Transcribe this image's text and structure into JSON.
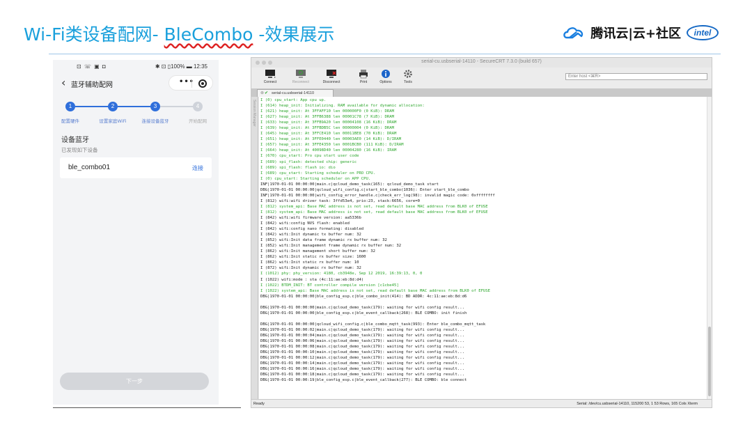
{
  "slide": {
    "title_prefix": "Wi-Fi类设备配网- ",
    "title_link": "BleCombo",
    "title_suffix": " -效果展示",
    "brand_text": "腾讯云|云+社区",
    "intel_logo": "intel"
  },
  "phone": {
    "status_left": "⊡ ☏ ▣ ◘",
    "status_right": "✱ ⊡ ▯100% ▬ 12:35",
    "back_icon": "chevron-left-icon",
    "nav_title": "蓝牙辅助配网",
    "capsule_dots": "•••",
    "steps": [
      {
        "number": "1",
        "label": "配置硬件",
        "done": true
      },
      {
        "number": "2",
        "label": "设置家庭WiFi",
        "done": true
      },
      {
        "number": "3",
        "label": "连接设备蓝牙",
        "done": true
      },
      {
        "number": "4",
        "label": "开始配网",
        "done": false
      }
    ],
    "colors": {
      "step_active": "#2f6fdb",
      "step_inactive": "#cfd3da"
    },
    "section_title": "设备蓝牙",
    "section_sub": "已发现如下设备",
    "device_name": "ble_combo01",
    "connect_label": "连接",
    "next_label": "下一步"
  },
  "terminal": {
    "window_title": "serial-cu.usbserial-14110 - SecureCRT 7.3.0 (build 657)",
    "toolbar": [
      {
        "label": "Connect",
        "icon": "monitor-icon",
        "enabled": true
      },
      {
        "label": "Reconnect",
        "icon": "monitor-refresh-icon",
        "enabled": false
      },
      {
        "label": "Disconnect",
        "icon": "monitor-disconnect-icon",
        "enabled": true
      },
      {
        "label": "Print",
        "icon": "print-icon",
        "enabled": true
      },
      {
        "label": "Options",
        "icon": "options-info-icon",
        "enabled": true
      },
      {
        "label": "Tools",
        "icon": "gear-icon",
        "enabled": true
      }
    ],
    "host_placeholder": "Enter host <⌘R>",
    "tab_label": "serial-cu.usbserial-14110",
    "sessions_label": "Session Manager",
    "status_ready": "Ready",
    "status_info": "Serial: /dev/cu.usbserial-14110, 115200   53, 1   53 Rows, 165 Cols   Xterm",
    "log": [
      {
        "t": "I (0) cpu_start: App cpu up.",
        "c": "green"
      },
      {
        "t": "I (614) heap_init: Initializing. RAM available for dynamic allocation:",
        "c": "green"
      },
      {
        "t": "I (621) heap_init: At 3FFAFF10 len 000000F0 (0 KiB): DRAM",
        "c": "green"
      },
      {
        "t": "I (627) heap_init: At 3FFB6388 len 00001C78 (7 KiB): DRAM",
        "c": "green"
      },
      {
        "t": "I (633) heap_init: At 3FFB9A20 len 00004108 (16 KiB): DRAM",
        "c": "green"
      },
      {
        "t": "I (639) heap_init: At 3FFBDB5C len 00000004 (0 KiB): DRAM",
        "c": "green"
      },
      {
        "t": "I (645) heap_init: At 3FFCE410 len 00011BE8 (70 KiB): DRAM",
        "c": "green"
      },
      {
        "t": "I (651) heap_init: At 3FFE0440 len 00003AE0 (14 KiB): D/IRAM",
        "c": "green"
      },
      {
        "t": "I (657) heap_init: At 3FFE4350 len 0001BCB0 (111 KiB): D/IRAM",
        "c": "green"
      },
      {
        "t": "I (664) heap_init: At 40098D40 len 00004280 (16 KiB): IRAM",
        "c": "green"
      },
      {
        "t": "I (670) cpu_start: Pro cpu start user code",
        "c": "green"
      },
      {
        "t": "I (689) spi_flash: detected chip: generic",
        "c": "green"
      },
      {
        "t": "I (689) spi_flash: flash io: dio",
        "c": "green"
      },
      {
        "t": "I (689) cpu_start: Starting scheduler on PRO CPU.",
        "c": "green"
      },
      {
        "t": "I (0) cpu_start: Starting scheduler on APP CPU.",
        "c": "green"
      },
      {
        "t": "INF|1970-01-01 00:00:00|main.c|qcloud_demo_task(165): qcloud_demo_task start",
        "c": ""
      },
      {
        "t": "DBG|1970-01-01 00:00:00|qcloud_wifi_config.c|start_ble_combo(1036): Enter start_ble_combo",
        "c": ""
      },
      {
        "t": "INF|1970-01-01 00:00:00|wifi_config_error_handle.c|check_err_log(98): invalid magic code: 0xffffffff",
        "c": ""
      },
      {
        "t": "I (812) wifi:wifi driver task: 3ffd53e4, prio:23, stack:6656, core=0",
        "c": ""
      },
      {
        "t": "I (812) system_api: Base MAC address is not set, read default base MAC address from BLK0 of EFUSE",
        "c": "green"
      },
      {
        "t": "I (812) system_api: Base MAC address is not set, read default base MAC address from BLK0 of EFUSE",
        "c": "green"
      },
      {
        "t": "I (842) wifi:wifi firmware version: aa5336b",
        "c": ""
      },
      {
        "t": "I (842) wifi:config NVS flash: enabled",
        "c": ""
      },
      {
        "t": "I (842) wifi:config nano formating: disabled",
        "c": ""
      },
      {
        "t": "I (842) wifi:Init dynamic tx buffer num: 32",
        "c": ""
      },
      {
        "t": "I (852) wifi:Init data frame dynamic rx buffer num: 32",
        "c": ""
      },
      {
        "t": "I (852) wifi:Init management frame dynamic rx buffer num: 32",
        "c": ""
      },
      {
        "t": "I (862) wifi:Init management short buffer num: 32",
        "c": ""
      },
      {
        "t": "I (862) wifi:Init static rx buffer size: 1600",
        "c": ""
      },
      {
        "t": "I (862) wifi:Init static rx buffer num: 10",
        "c": ""
      },
      {
        "t": "I (872) wifi:Init dynamic rx buffer num: 32",
        "c": ""
      },
      {
        "t": "I (1012) phy: phy_version: 4180, cb3948e, Sep 12 2019, 16:39:13, 0, 0",
        "c": "green"
      },
      {
        "t": "I (1022) wifi:mode : sta (4c:11:ae:eb:8d:d4)",
        "c": ""
      },
      {
        "t": "I (1022) BTDM_INIT: BT controller compile version [c1cbe45]",
        "c": "green"
      },
      {
        "t": "I (1022) system_api: Base MAC address is not set, read default base MAC address from BLK0 of EFUSE",
        "c": "green"
      },
      {
        "t": "DBG|1970-01-01 00:00:00|ble_config_esp.c|ble_combo_init(414): BD ADDR: 4c:11:ae:eb:8d:d6",
        "c": ""
      },
      {
        "t": "",
        "c": ""
      },
      {
        "t": "DBG|1970-01-01 00:00:00|main.c|qcloud_demo_task(179): waiting for wifi config result...",
        "c": ""
      },
      {
        "t": "DBG|1970-01-01 00:00:00|ble_config_esp.c|ble_event_callback(268): BLE COMBO: init finish",
        "c": ""
      },
      {
        "t": "",
        "c": ""
      },
      {
        "t": "DBG|1970-01-01 00:00:00|qcloud_wifi_config.c|ble_combo_mqtt_task(993): Enter ble_combo_mqtt_task",
        "c": ""
      },
      {
        "t": "DBG|1970-01-01 00:00:02|main.c|qcloud_demo_task(179): waiting for wifi config result...",
        "c": ""
      },
      {
        "t": "DBG|1970-01-01 00:00:04|main.c|qcloud_demo_task(179): waiting for wifi config result...",
        "c": ""
      },
      {
        "t": "DBG|1970-01-01 00:00:06|main.c|qcloud_demo_task(179): waiting for wifi config result...",
        "c": ""
      },
      {
        "t": "DBG|1970-01-01 00:00:08|main.c|qcloud_demo_task(179): waiting for wifi config result...",
        "c": ""
      },
      {
        "t": "DBG|1970-01-01 00:00:10|main.c|qcloud_demo_task(179): waiting for wifi config result...",
        "c": ""
      },
      {
        "t": "DBG|1970-01-01 00:00:12|main.c|qcloud_demo_task(179): waiting for wifi config result...",
        "c": ""
      },
      {
        "t": "DBG|1970-01-01 00:00:14|main.c|qcloud_demo_task(179): waiting for wifi config result...",
        "c": ""
      },
      {
        "t": "DBG|1970-01-01 00:00:16|main.c|qcloud_demo_task(179): waiting for wifi config result...",
        "c": ""
      },
      {
        "t": "DBG|1970-01-01 00:00:18|main.c|qcloud_demo_task(179): waiting for wifi config result...",
        "c": ""
      },
      {
        "t": "DBG|1970-01-01 00:00:19|ble_config_esp.c|ble_event_callback(277): BLE COMBO: ble connect",
        "c": ""
      }
    ],
    "colors": {
      "log_green": "#2aa52a",
      "log_default": "#1a1a1a"
    }
  }
}
